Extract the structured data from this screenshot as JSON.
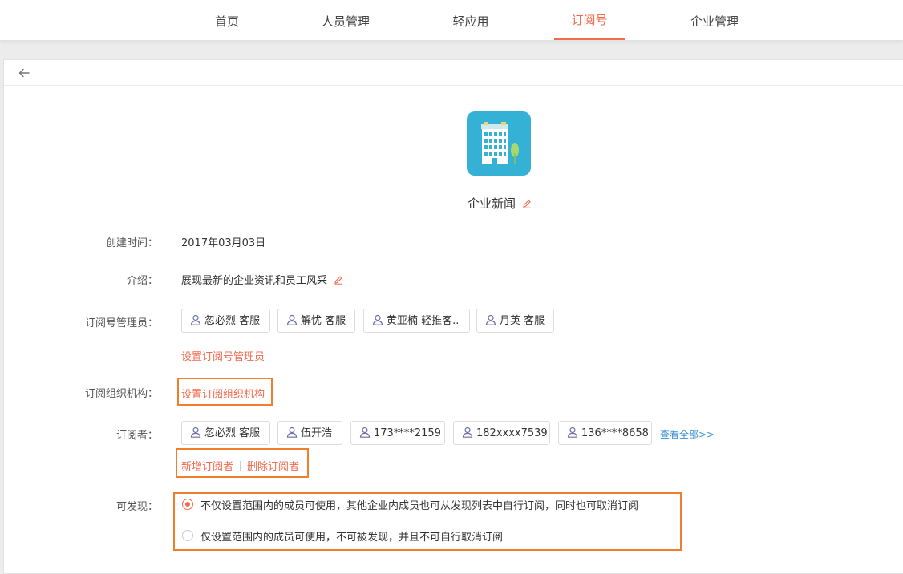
{
  "nav": {
    "items": [
      {
        "label": "首页"
      },
      {
        "label": "人员管理"
      },
      {
        "label": "轻应用"
      },
      {
        "label": "订阅号"
      },
      {
        "label": "企业管理"
      }
    ],
    "active_index": 3
  },
  "colors": {
    "accent": "#f06a4e",
    "highlight_box": "#f07e2a",
    "link_blue": "#3b8fd1",
    "icon_bg": "#36b1d6"
  },
  "icons": {
    "back": "arrow-left-icon",
    "edit": "pencil-icon",
    "user": "user-icon",
    "app": "building-icon"
  },
  "app": {
    "name": "企业新闻"
  },
  "fields": {
    "created": {
      "label": "创建时间：",
      "value": "2017年03月03日"
    },
    "intro": {
      "label": "介绍：",
      "value": "展现最新的企业资讯和员工风采"
    },
    "admins": {
      "label": "订阅号管理员：",
      "chips": [
        "忽必烈 客服",
        "解忧 客服",
        "黄亚楠 轻推客..",
        "月英 客服"
      ],
      "set_link": "设置订阅号管理员"
    },
    "org": {
      "label": "订阅组织机构：",
      "set_link": "设置订阅组织机构"
    },
    "subscribers": {
      "label": "订阅者：",
      "chips": [
        "忽必烈 客服",
        "伍开浩",
        "173****2159",
        "182xxxx7539",
        "136****8658"
      ],
      "view_all": "查看全部>>",
      "add_link": "新增订阅者",
      "remove_link": "删除订阅者"
    },
    "discover": {
      "label": "可发现：",
      "options": [
        {
          "text": "不仅设置范围内的成员可使用，其他企业内成员也可从发现列表中自行订阅，同时也可取消订阅",
          "checked": true
        },
        {
          "text": "仅设置范围内的成员可使用，不可被发现，并且不可自行取消订阅",
          "checked": false
        }
      ]
    }
  }
}
